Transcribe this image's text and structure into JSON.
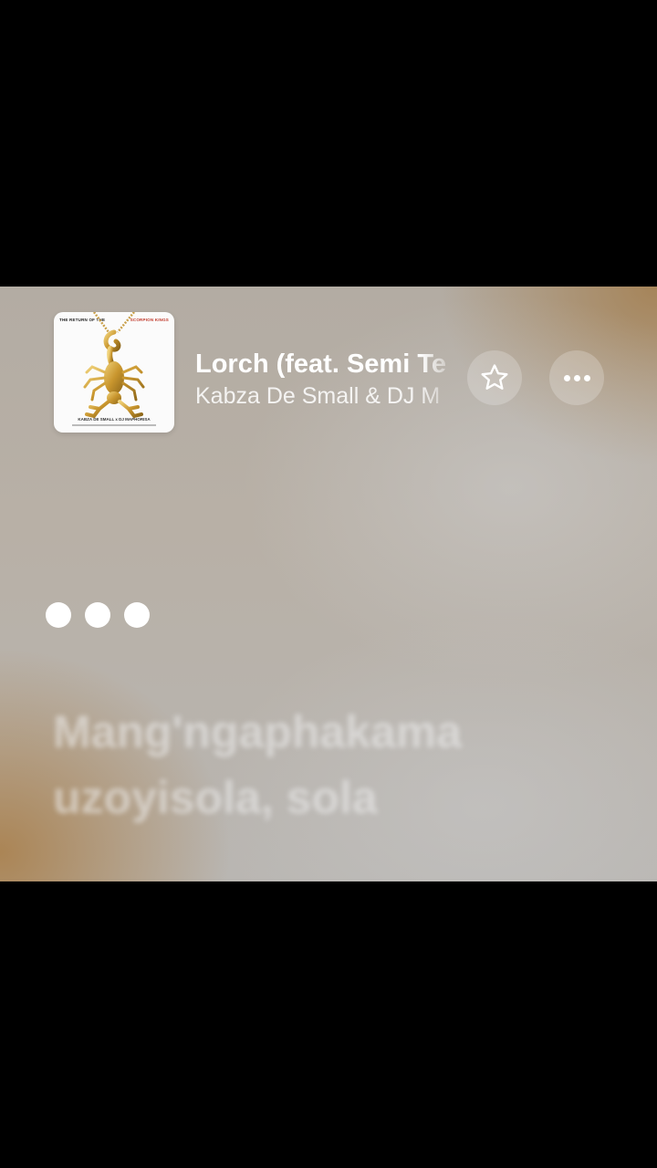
{
  "album_art": {
    "top_left_text": "THE RETURN OF THE",
    "top_right_text": "SCORPION KINGS",
    "bottom_text": "KABZA DE SMALL x DJ MAPHORISA"
  },
  "now_playing": {
    "title": "Lorch (feat. Semi Te",
    "artist": "Kabza De Small & DJ M"
  },
  "icons": {
    "favorite": "star-icon",
    "more": "ellipsis-icon",
    "typing": "typing-dots-icon"
  },
  "lyrics": {
    "line1": "Mang'ngaphakama",
    "line2": "uzoyisola, sola"
  },
  "colors": {
    "accent_white": "#ffffff",
    "background": "#000000"
  }
}
